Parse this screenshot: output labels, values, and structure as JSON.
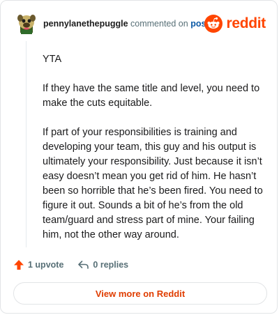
{
  "header": {
    "username": "pennylanethepuggle",
    "action_text": "commented on",
    "post_link": "post",
    "brand_name": "reddit",
    "brand_color": "#ff4500"
  },
  "comment": {
    "paragraphs": [
      "YTA",
      "If they have the same title and level, you need to make the cuts equitable.",
      "If part of your responsibilities is training and developing your team, this guy and his output is ultimately your responsibility. Just because it isn’t easy doesn’t mean you get rid of him. He hasn’t been so horrible that he’s been fired. You need to figure it out. Sounds a bit of he’s from the old team/guard and stress part of mine. Your failing him, not the other way around."
    ]
  },
  "actions": {
    "upvote_label": "1 upvote",
    "replies_label": "0 replies",
    "upvote_icon": "upvote-arrow-icon",
    "reply_icon": "reply-arrow-icon"
  },
  "footer": {
    "view_more_label": "View more on Reddit",
    "link_color": "#e03d00"
  }
}
